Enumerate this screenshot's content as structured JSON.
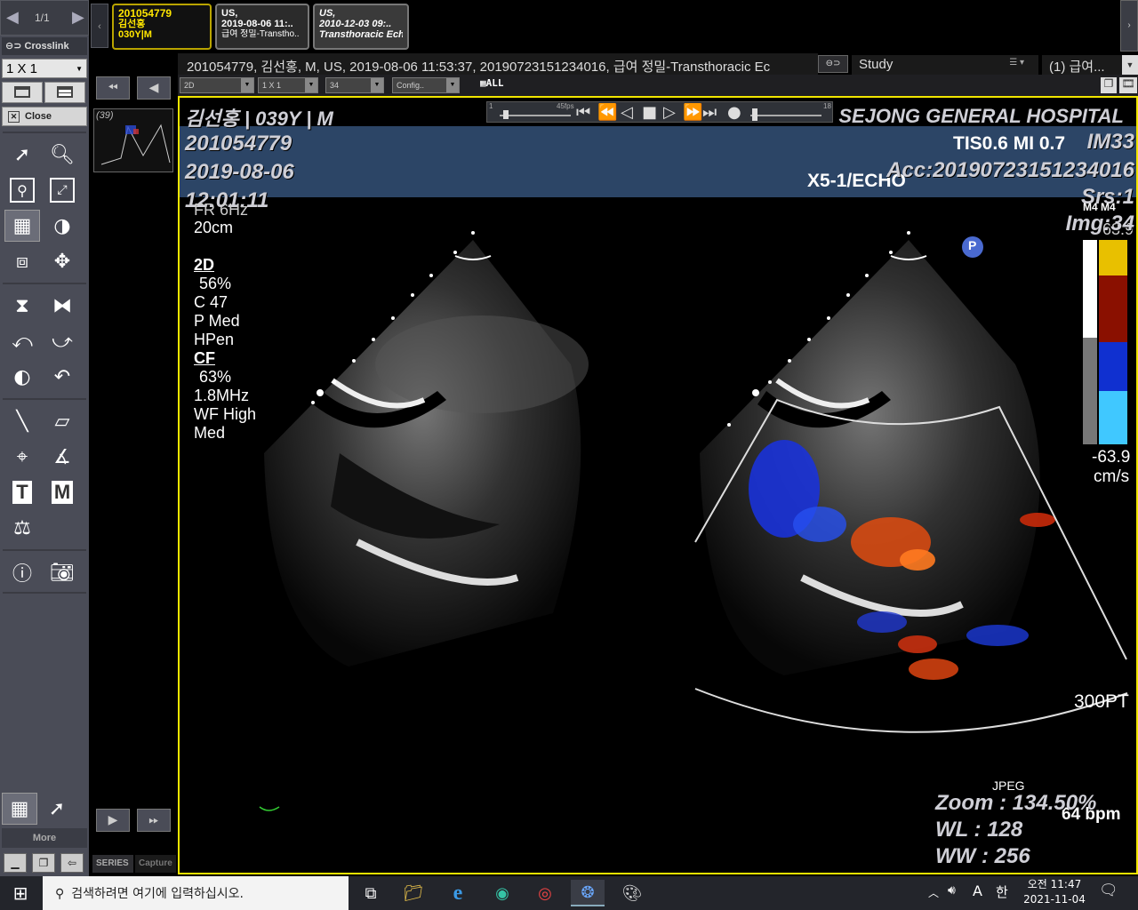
{
  "pager": {
    "label": "1/1"
  },
  "crosslink": {
    "label": "Crosslink"
  },
  "layout": {
    "value": "1 X 1"
  },
  "close_label": "Close",
  "more_label": "More",
  "series_tabs": [
    "SERIES",
    "Capture"
  ],
  "study_tabs": [
    {
      "lines": [
        "201054779",
        "김선홍",
        "030Y|M"
      ],
      "active": true
    },
    {
      "lines": [
        "US,",
        "2019-08-06 11:..",
        "급여 정밀-Transtho.."
      ],
      "active": false
    },
    {
      "lines": [
        "US,",
        "2010-12-03 09:..",
        "Transthoracic Ech.."
      ],
      "active": false
    }
  ],
  "header": {
    "info": "201054779, 김선홍, M, US, 2019-08-06 11:53:37, 20190723151234016, 급여 정밀-Transthoracic Ec",
    "study_label": "Study",
    "study_value": "(1) 급여..."
  },
  "subbar": {
    "mode": "2D",
    "grid": "1 X 1",
    "frame": "34",
    "config": "Config..",
    "all": "ALL"
  },
  "thumb": {
    "count": "(39)"
  },
  "player": {
    "speed_min": "1",
    "speed_label": "45fps",
    "speed_max": "18"
  },
  "overlay": {
    "name_age": "김선홍 | 039Y | M",
    "patient_id": "201054779",
    "date": "2019-08-06",
    "time": "12:01:11",
    "hospital": "SEJONG GENERAL HOSPITAL",
    "image_no": "IM33",
    "acc": "Acc:20190723151234016",
    "srs": "Srs:1",
    "img": "Img:34",
    "zoom": "Zoom : 134.50%",
    "wl": "WL : 128",
    "ww": "WW : 256"
  },
  "us": {
    "tis_mi": "TIS0.6    MI 0.7",
    "probe": "X5-1/ECHO",
    "fr": "FR 6Hz",
    "depth": "20cm",
    "params_2d": [
      "2D",
      "56%",
      "C 47",
      "P Med",
      "HPen"
    ],
    "params_cf": [
      "CF",
      "63%",
      "1.8MHz",
      "WF High",
      "Med"
    ],
    "cbar_label": "M4 M4",
    "cbar_top": "63.9",
    "cbar_bottom": "-63.9",
    "cbar_unit": "cm/s",
    "p_marker": "P",
    "right_label": "300PT",
    "compression": "JPEG",
    "bpm": "64 bpm"
  },
  "taskbar": {
    "search_placeholder": "검색하려면 여기에 입력하십시오.",
    "ime_a": "A",
    "ime_han": "한",
    "time": "오전 11:47",
    "date": "2021-11-04"
  }
}
